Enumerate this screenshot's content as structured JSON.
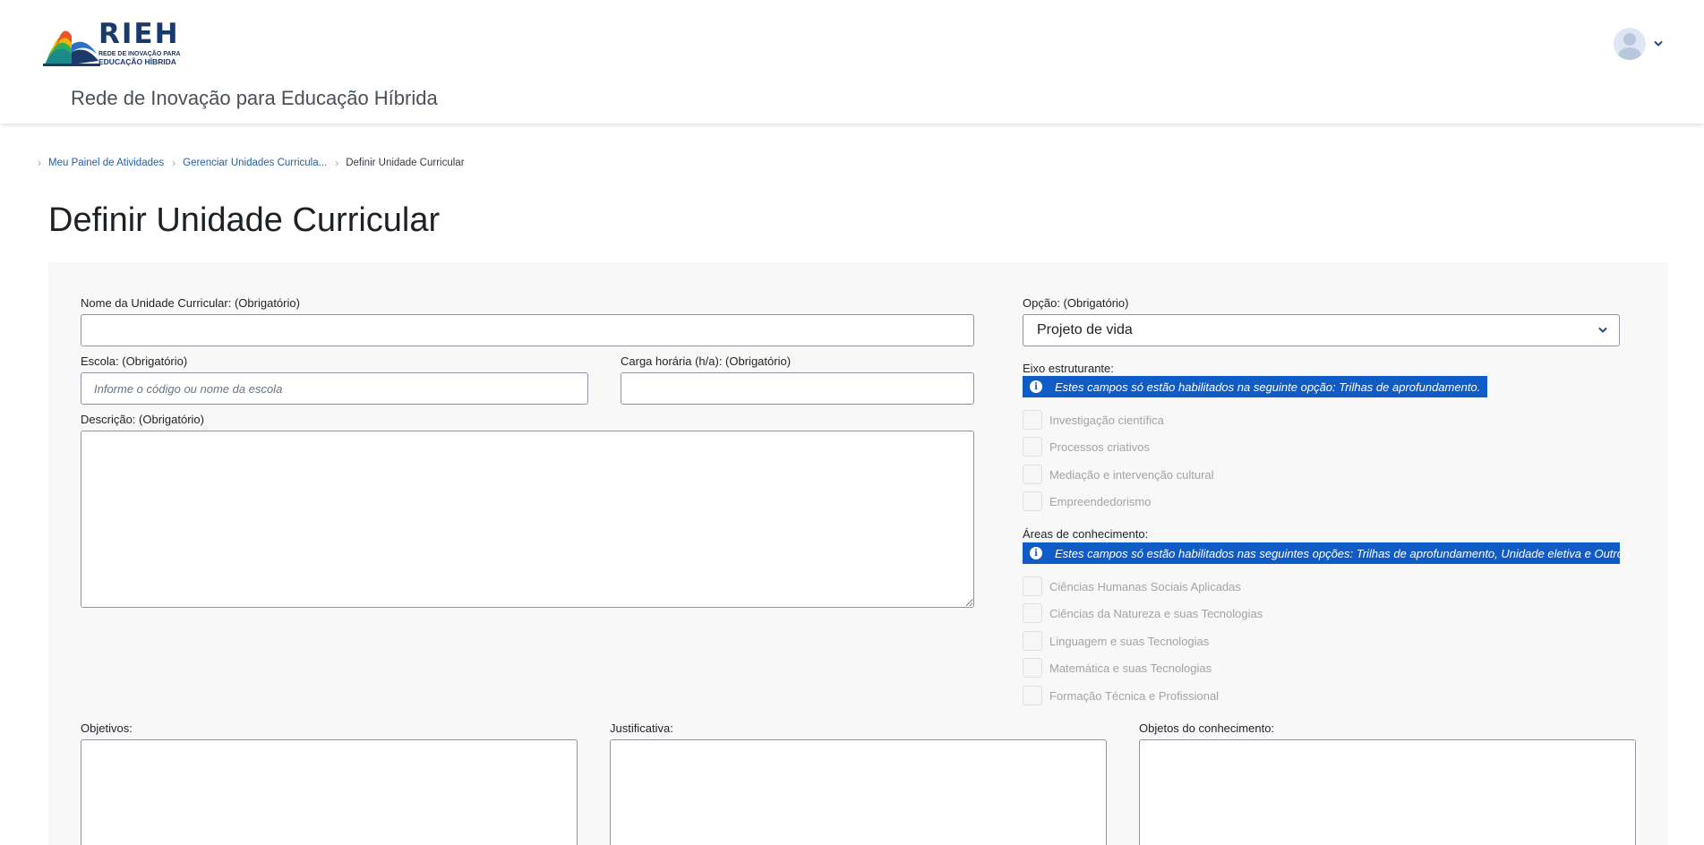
{
  "header": {
    "logo_word": "RIEH",
    "logo_line1": "REDE DE INOVAÇÃO PARA",
    "logo_line2": "EDUCAÇÃO HÍBRIDA",
    "site_name": "Rede de Inovação para Educação Híbrida",
    "user_icon": "user-avatar-icon",
    "menu_icon": "chevron-down-icon"
  },
  "breadcrumb": {
    "items": [
      {
        "label": "Meu Painel de Atividades"
      },
      {
        "label": "Gerenciar Unidades Curricula..."
      },
      {
        "label": "Definir Unidade Curricular"
      }
    ],
    "separator_icon": "chevron-right-icon"
  },
  "page": {
    "title": "Definir Unidade Curricular"
  },
  "form": {
    "nome": {
      "label": "Nome da Unidade Curricular: (Obrigatório)",
      "value": ""
    },
    "escola": {
      "label": "Escola: (Obrigatório)",
      "placeholder": "Informe o código ou nome da escola",
      "value": ""
    },
    "carga": {
      "label": "Carga horária (h/a): (Obrigatório)",
      "value": ""
    },
    "descricao": {
      "label": "Descrição: (Obrigatório)",
      "value": ""
    },
    "opcao": {
      "label": "Opção: (Obrigatório)",
      "selected": "Projeto de vida"
    },
    "eixo": {
      "label": "Eixo estruturante:",
      "info": "Estes campos só estão habilitados na seguinte opção: Trilhas de aprofundamento.",
      "options": [
        {
          "label": "Investigação científica"
        },
        {
          "label": "Processos criativos"
        },
        {
          "label": "Mediação e intervenção cultural"
        },
        {
          "label": "Empreendedorismo"
        }
      ]
    },
    "areas": {
      "label": "Áreas de conhecimento:",
      "info": "Estes campos só estão habilitados nas seguintes opções: Trilhas de aprofundamento, Unidade eletiva e Outros.",
      "options": [
        {
          "label": "Ciências Humanas Sociais Aplicadas"
        },
        {
          "label": "Ciências da Natureza e suas Tecnologias"
        },
        {
          "label": "Linguagem e suas Tecnologias"
        },
        {
          "label": "Matemática e suas Tecnologias"
        },
        {
          "label": "Formação Técnica e Profissional"
        }
      ]
    },
    "objetivos": {
      "label": "Objetivos:",
      "value": ""
    },
    "justificativa": {
      "label": "Justificativa:",
      "value": ""
    },
    "objetos": {
      "label": "Objetos do conhecimento:",
      "value": ""
    }
  },
  "colors": {
    "brand": "#1a3a6b",
    "info_banner": "#0f5cc7",
    "link": "#1f5fa8",
    "panel_bg": "#f8f8f8"
  }
}
